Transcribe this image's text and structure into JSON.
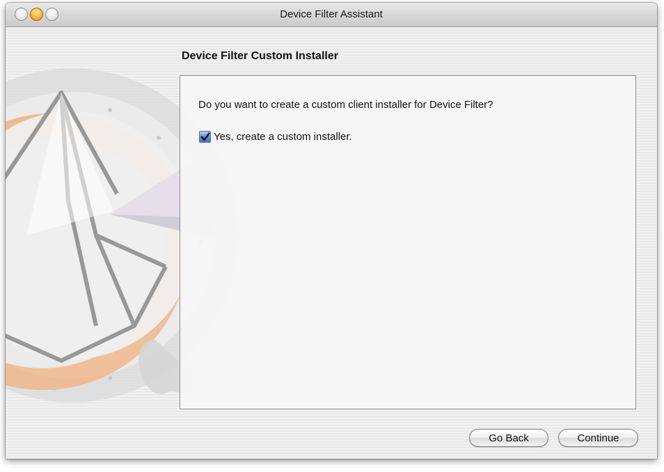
{
  "window": {
    "title": "Device Filter Assistant",
    "traffic_lights": [
      "close",
      "minimize",
      "zoom"
    ]
  },
  "page": {
    "heading": "Device Filter Custom Installer",
    "question": "Do you want to create a custom client installer for Device Filter?",
    "checkbox": {
      "label": "Yes, create a custom installer.",
      "checked": true
    }
  },
  "buttons": {
    "back_label": "Go Back",
    "continue_label": "Continue"
  },
  "colors": {
    "accent_checkbox": "#3d78cc",
    "art_orange": "#f0b27e",
    "minimize_light": "#f6b73a"
  },
  "icons": {
    "background_art": "assistant-compass-icon",
    "checkmark": "checkmark-icon"
  }
}
